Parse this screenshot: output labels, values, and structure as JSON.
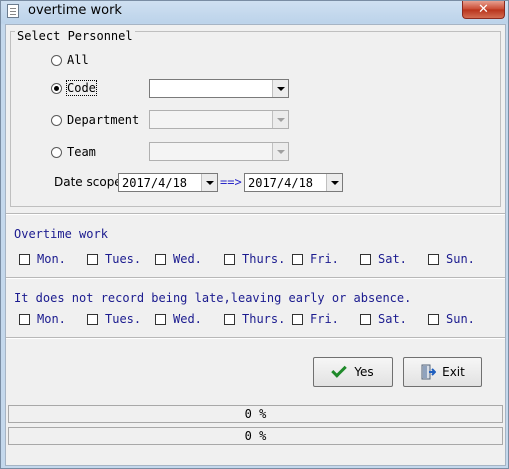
{
  "window": {
    "title": "overtime work",
    "close_glyph": "✕"
  },
  "personnel": {
    "group_label": "Select Personnel",
    "options": [
      {
        "label": "All",
        "checked": false
      },
      {
        "label": "Code",
        "checked": true
      },
      {
        "label": "Department",
        "checked": false
      },
      {
        "label": "Team",
        "checked": false
      }
    ],
    "code_value": "",
    "department_value": "",
    "team_value": ""
  },
  "date_scope": {
    "label": "Date scope",
    "from": "2017/4/18",
    "arrow": "==>",
    "to": "2017/4/18"
  },
  "overtime": {
    "title": "Overtime work",
    "days": [
      "Mon.",
      "Tues.",
      "Wed.",
      "Thurs.",
      "Fri.",
      "Sat.",
      "Sun."
    ]
  },
  "no_record": {
    "title": "It does not record being late,leaving early  or absence.",
    "days": [
      "Mon.",
      "Tues.",
      "Wed.",
      "Thurs.",
      "Fri.",
      "Sat.",
      "Sun."
    ]
  },
  "buttons": {
    "yes": "Yes",
    "exit": "Exit"
  },
  "progress": [
    {
      "text": "0 %",
      "value": 0
    },
    {
      "text": "0 %",
      "value": 0
    }
  ]
}
